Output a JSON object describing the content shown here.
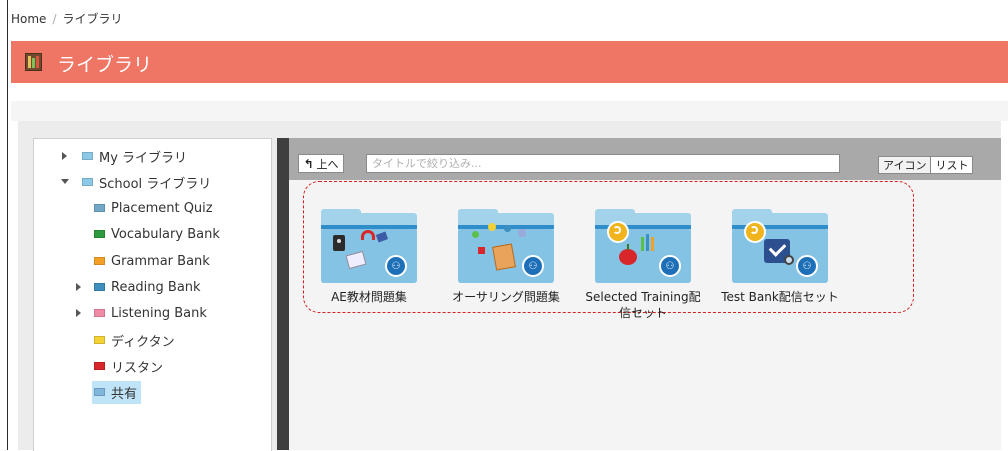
{
  "breadcrumb": {
    "home": "Home",
    "separator": "/",
    "current": "ライブラリ"
  },
  "header": {
    "title": "ライブラリ",
    "icon": "bookshelf-icon",
    "color": "#ef7565"
  },
  "tree": {
    "items": [
      {
        "label": "My ライブラリ",
        "arrow": "right",
        "color": "#8cc8e8"
      },
      {
        "label": "School ライブラリ",
        "arrow": "down",
        "color": "#8cc8e8"
      },
      {
        "label": "Placement Quiz",
        "arrow": "none",
        "color": "#6fa8c9"
      },
      {
        "label": "Vocabulary Bank",
        "arrow": "none",
        "color": "#2e9a3e"
      },
      {
        "label": "Grammar Bank",
        "arrow": "none",
        "color": "#f2a126"
      },
      {
        "label": "Reading Bank",
        "arrow": "right",
        "color": "#3c8fbf"
      },
      {
        "label": "Listening Bank",
        "arrow": "right",
        "color": "#f08aa5"
      },
      {
        "label": "ディクタン",
        "arrow": "none",
        "color": "#f4d235"
      },
      {
        "label": "リスタン",
        "arrow": "none",
        "color": "#d9262b"
      },
      {
        "label": "共有",
        "arrow": "none",
        "color": "#7fb7dc",
        "selected": true
      }
    ]
  },
  "toolbar": {
    "up_label": "上へ",
    "up_icon": "up-arrow-icon",
    "filter_placeholder": "タイトルで絞り込み...",
    "icon_view_label": "アイコン",
    "list_view_label": "リスト"
  },
  "files": [
    {
      "label": "AE教材問題集"
    },
    {
      "label": "オーサリング問題集"
    },
    {
      "label": "Selected Training配信セット"
    },
    {
      "label": "Test Bank配信セット"
    }
  ],
  "accent_color": "#d62020"
}
